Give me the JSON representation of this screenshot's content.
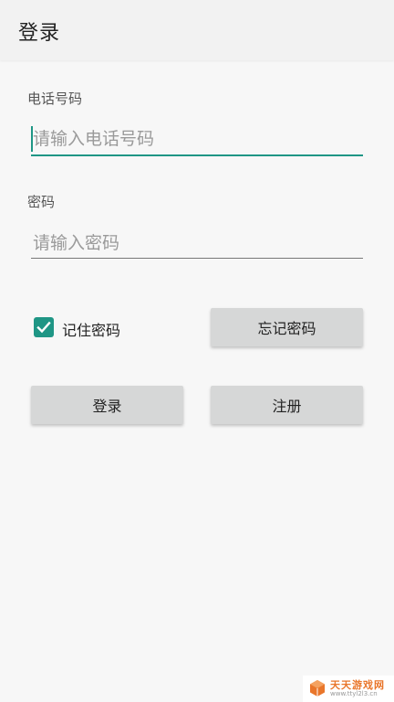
{
  "appbar": {
    "title": "登录"
  },
  "phone": {
    "label": "电话号码",
    "placeholder": "请输入电话号码",
    "value": ""
  },
  "password": {
    "label": "密码",
    "placeholder": "请输入密码",
    "value": ""
  },
  "remember": {
    "label": "记住密码",
    "checked": true
  },
  "buttons": {
    "forgot_label": "忘记密码",
    "login_label": "登录",
    "register_label": "注册"
  },
  "watermark": {
    "text": "天天游戏网",
    "url": "www.ttyl2l3.cn"
  },
  "colors": {
    "accent": "#1f9685",
    "button_bg": "#d6d7d7",
    "background": "#f7f7f7"
  },
  "icons": {
    "checkbox": "check-icon",
    "watermark_logo": "cube-logo-icon"
  }
}
